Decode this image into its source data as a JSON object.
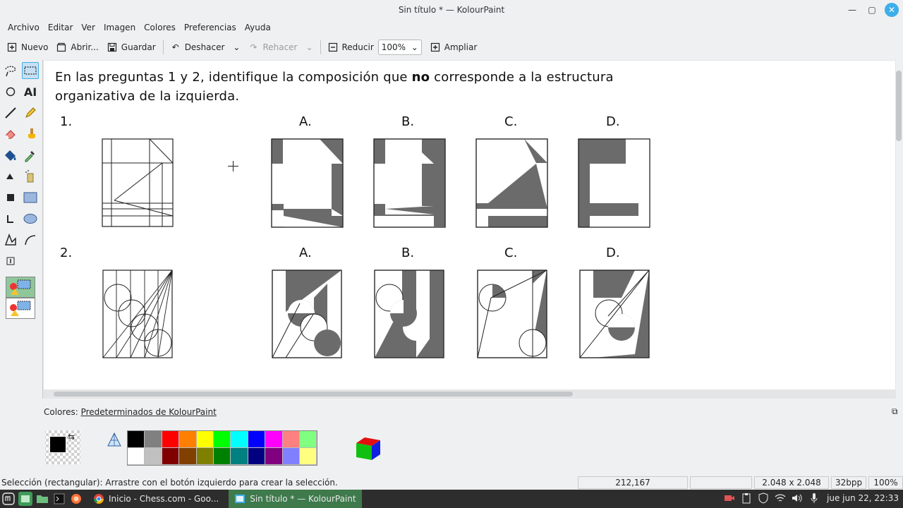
{
  "window": {
    "title": "Sin título * — KolourPaint",
    "minimize": "—",
    "maximize": "▢",
    "close": "✕"
  },
  "menu": [
    "Archivo",
    "Editar",
    "Ver",
    "Imagen",
    "Colores",
    "Preferencias",
    "Ayuda"
  ],
  "toolbar": {
    "new": "Nuevo",
    "open": "Abrir...",
    "save": "Guardar",
    "undo": "Deshacer",
    "redo": "Rehacer",
    "zoom_out": "Reducir",
    "zoom_value": "100%",
    "zoom_in": "Ampliar"
  },
  "document": {
    "question_before": "En las preguntas 1 y 2, identifique la composición que ",
    "question_bold": "no",
    "question_after": " corresponde a la estructura organizativa de la izquierda.",
    "q1": "1.",
    "q2": "2.",
    "options": [
      "A.",
      "B.",
      "C.",
      "D."
    ]
  },
  "colors_panel": {
    "label_prefix": "Colores: ",
    "label_name": "Predeterminados de KolourPaint",
    "palette_top": [
      "#000000",
      "#808080",
      "#ff0000",
      "#ff8000",
      "#ffff00",
      "#00ff00",
      "#00ffff",
      "#0000ff",
      "#ff00ff",
      "#ff8080",
      "#80ff80"
    ],
    "palette_bottom": [
      "#ffffff",
      "#c0c0c0",
      "#800000",
      "#804000",
      "#808000",
      "#008000",
      "#008080",
      "#000080",
      "#800080",
      "#8080ff",
      "#ffff80"
    ]
  },
  "status": {
    "message": "Selección (rectangular): Arrastre con el botón izquierdo para crear la selección.",
    "coords": "212,167",
    "size": "2.048 x 2.048",
    "depth": "32bpp",
    "zoom": "100%"
  },
  "taskbar": {
    "task_chrome": "Inicio - Chess.com - Goo...",
    "task_kolourpaint": "Sin título * — KolourPaint",
    "clock": "jue jun 22, 22:33"
  }
}
